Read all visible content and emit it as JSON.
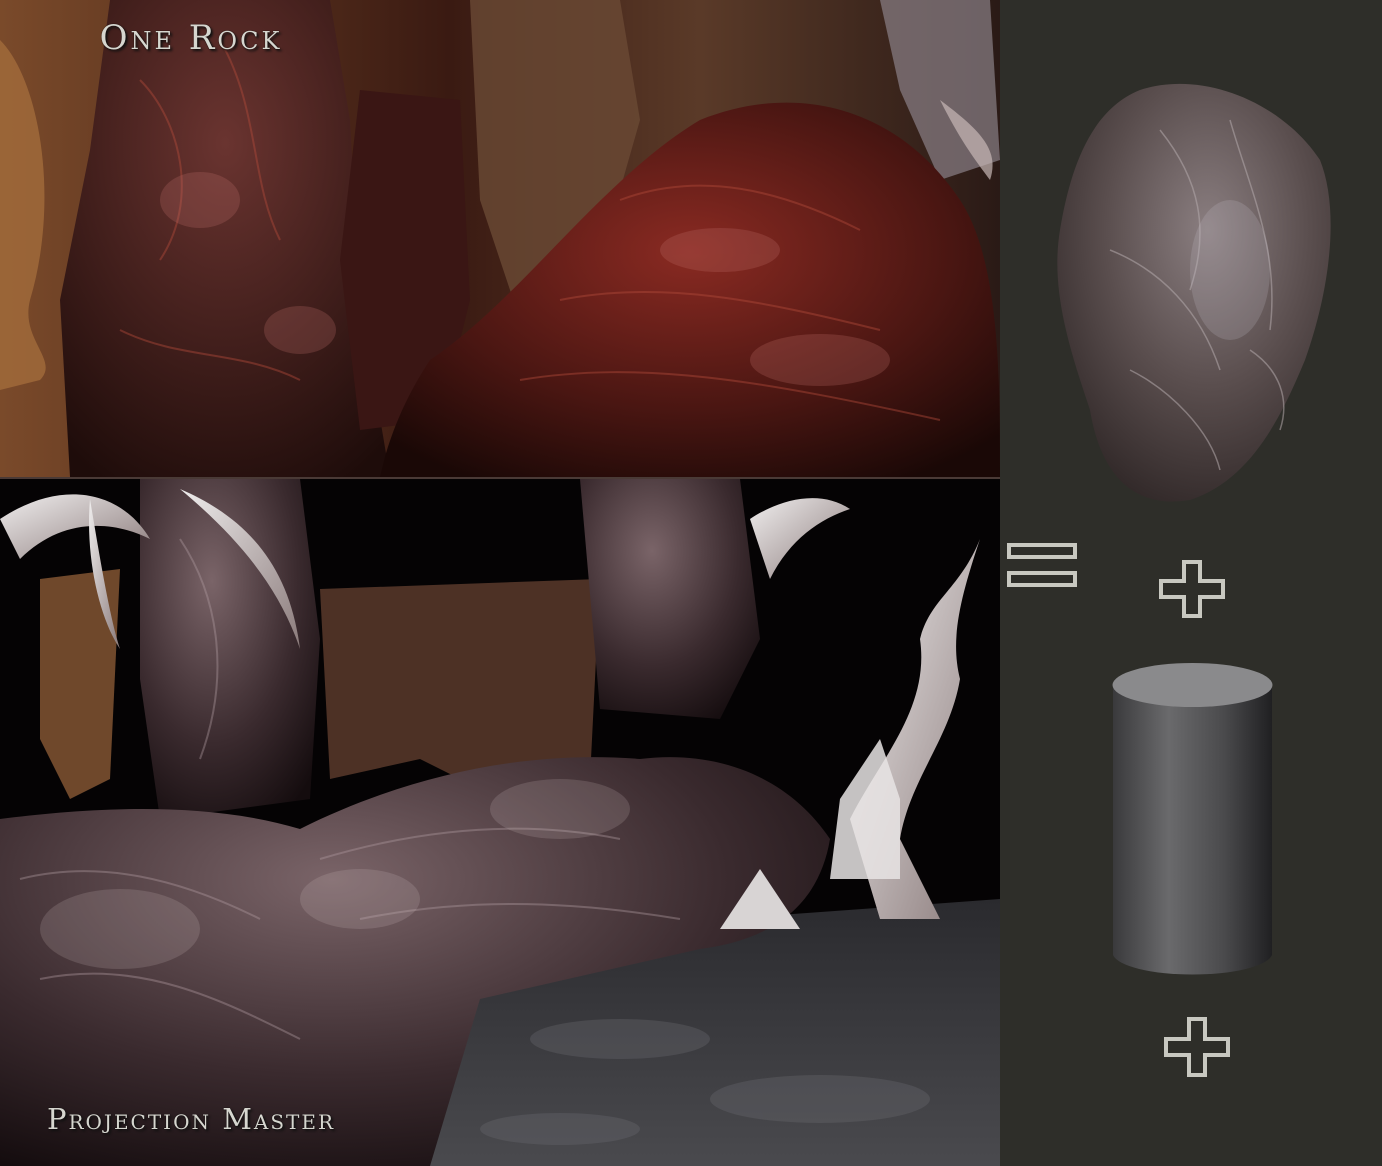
{
  "panel": {
    "title_top": "One Rock",
    "title_bottom": "Projection Master"
  },
  "icons": {
    "equals": "equals-icon",
    "plus_top": "plus-icon",
    "plus_bottom": "plus-icon"
  },
  "colors": {
    "panel_background": "#2e2e29",
    "label_text": "#d6d6cf"
  }
}
